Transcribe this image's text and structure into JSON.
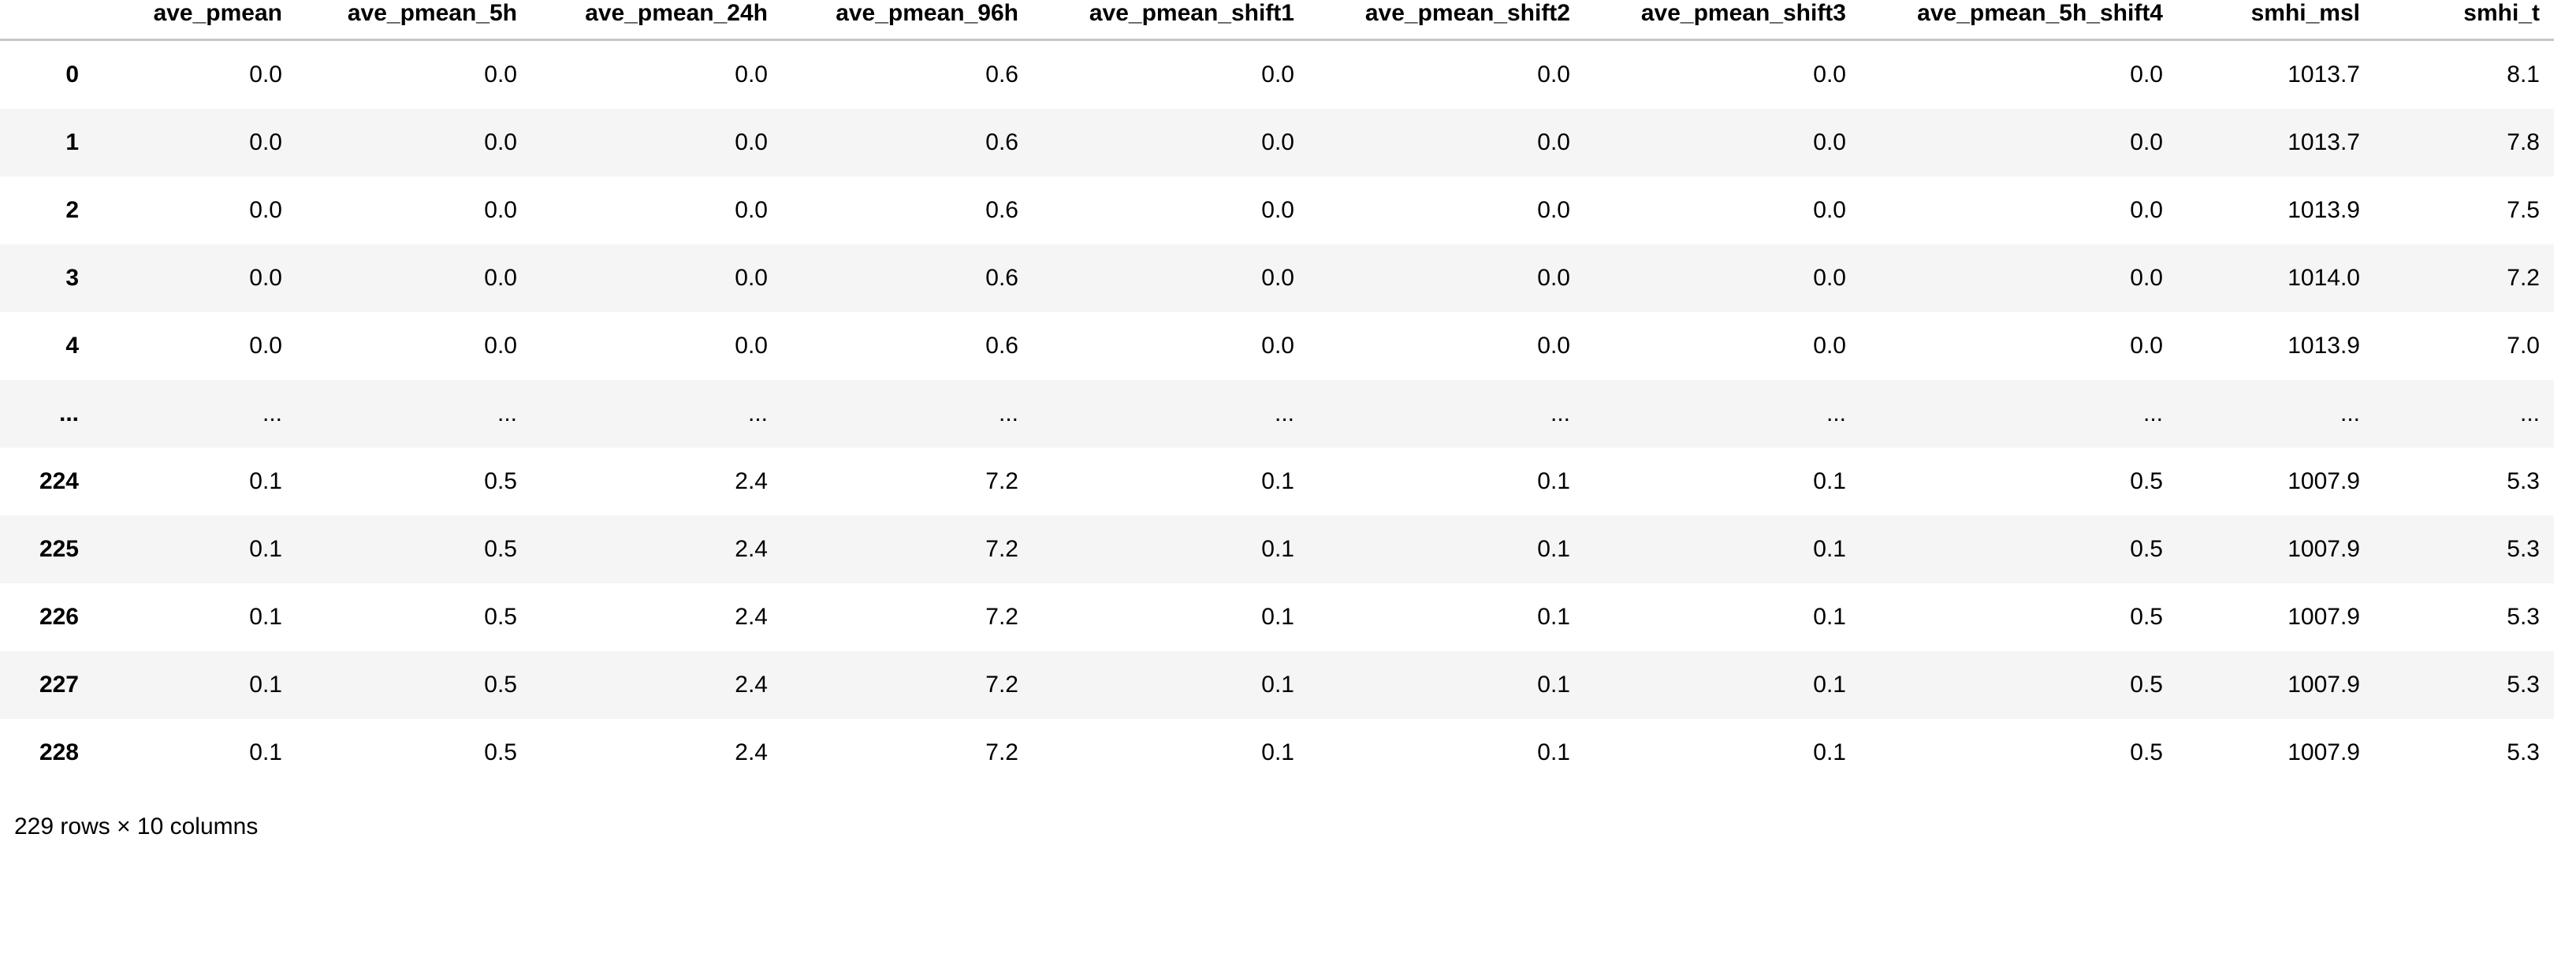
{
  "table": {
    "index_header": "",
    "columns": [
      "ave_pmean",
      "ave_pmean_5h",
      "ave_pmean_24h",
      "ave_pmean_96h",
      "ave_pmean_shift1",
      "ave_pmean_shift2",
      "ave_pmean_shift3",
      "ave_pmean_5h_shift4",
      "smhi_msl",
      "smhi_t"
    ],
    "rows": [
      {
        "index": "0",
        "cells": [
          "0.0",
          "0.0",
          "0.0",
          "0.6",
          "0.0",
          "0.0",
          "0.0",
          "0.0",
          "1013.7",
          "8.1"
        ]
      },
      {
        "index": "1",
        "cells": [
          "0.0",
          "0.0",
          "0.0",
          "0.6",
          "0.0",
          "0.0",
          "0.0",
          "0.0",
          "1013.7",
          "7.8"
        ]
      },
      {
        "index": "2",
        "cells": [
          "0.0",
          "0.0",
          "0.0",
          "0.6",
          "0.0",
          "0.0",
          "0.0",
          "0.0",
          "1013.9",
          "7.5"
        ]
      },
      {
        "index": "3",
        "cells": [
          "0.0",
          "0.0",
          "0.0",
          "0.6",
          "0.0",
          "0.0",
          "0.0",
          "0.0",
          "1014.0",
          "7.2"
        ]
      },
      {
        "index": "4",
        "cells": [
          "0.0",
          "0.0",
          "0.0",
          "0.6",
          "0.0",
          "0.0",
          "0.0",
          "0.0",
          "1013.9",
          "7.0"
        ]
      },
      {
        "index": "...",
        "cells": [
          "...",
          "...",
          "...",
          "...",
          "...",
          "...",
          "...",
          "...",
          "...",
          "..."
        ]
      },
      {
        "index": "224",
        "cells": [
          "0.1",
          "0.5",
          "2.4",
          "7.2",
          "0.1",
          "0.1",
          "0.1",
          "0.5",
          "1007.9",
          "5.3"
        ]
      },
      {
        "index": "225",
        "cells": [
          "0.1",
          "0.5",
          "2.4",
          "7.2",
          "0.1",
          "0.1",
          "0.1",
          "0.5",
          "1007.9",
          "5.3"
        ]
      },
      {
        "index": "226",
        "cells": [
          "0.1",
          "0.5",
          "2.4",
          "7.2",
          "0.1",
          "0.1",
          "0.1",
          "0.5",
          "1007.9",
          "5.3"
        ]
      },
      {
        "index": "227",
        "cells": [
          "0.1",
          "0.5",
          "2.4",
          "7.2",
          "0.1",
          "0.1",
          "0.1",
          "0.5",
          "1007.9",
          "5.3"
        ]
      },
      {
        "index": "228",
        "cells": [
          "0.1",
          "0.5",
          "2.4",
          "7.2",
          "0.1",
          "0.1",
          "0.1",
          "0.5",
          "1007.9",
          "5.3"
        ]
      }
    ],
    "shape_text": "229 rows × 10 columns",
    "row_count": 229,
    "column_count": 10
  },
  "style": {
    "header_rule_color": "#c6c6c6",
    "stripe_color": "#f5f5f5",
    "background": "#ffffff",
    "text_color": "#000000"
  }
}
